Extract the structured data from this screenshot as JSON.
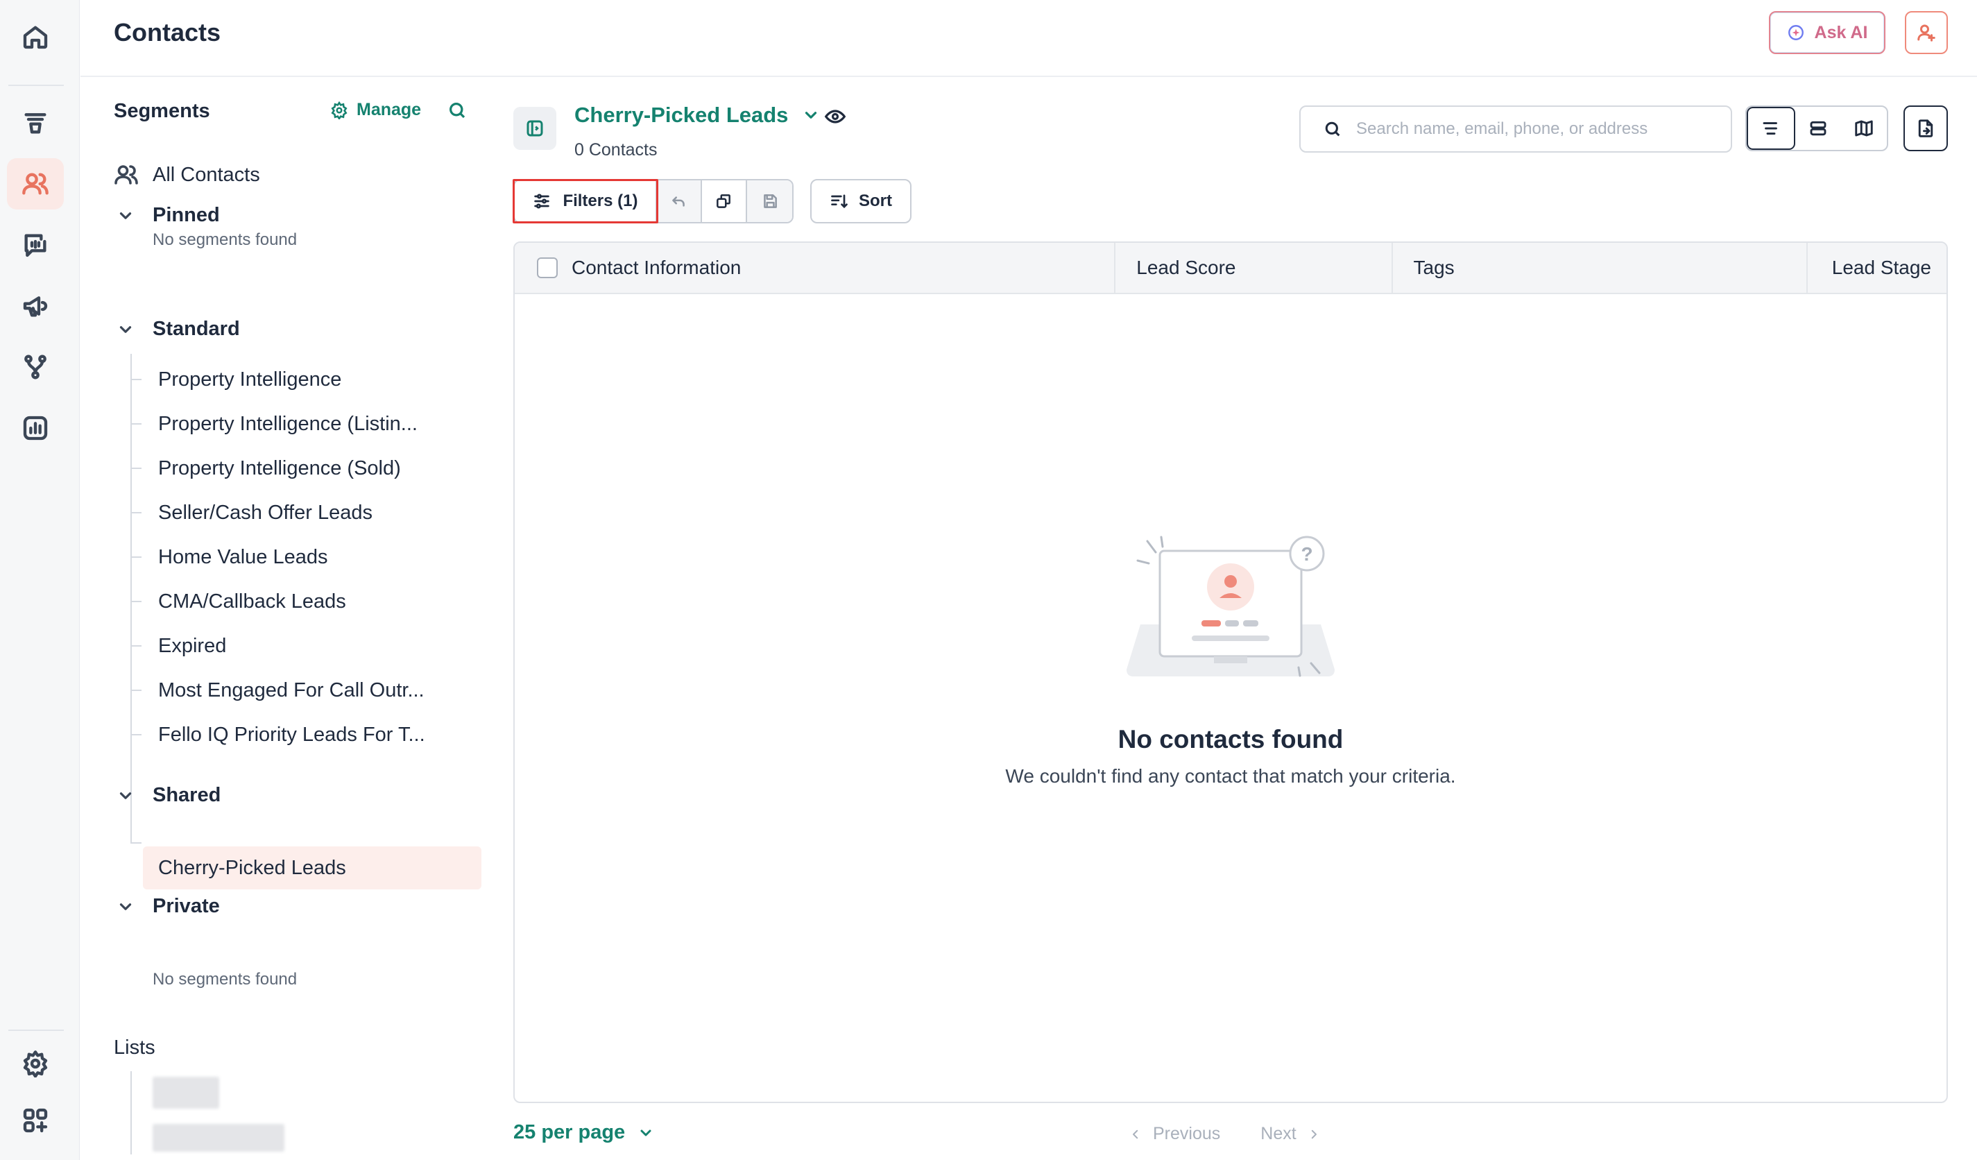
{
  "header": {
    "title": "Contacts",
    "ask_ai_label": "Ask AI"
  },
  "nav": {
    "items": [
      "home-icon",
      "funnel-icon",
      "contacts-icon",
      "messages-icon",
      "megaphone-icon",
      "workflow-icon",
      "reports-icon",
      "settings-icon",
      "apps-icon"
    ],
    "active": "contacts-icon",
    "accent": "#e8735f"
  },
  "segments": {
    "heading": "Segments",
    "manage_label": "Manage",
    "all_contacts_label": "All Contacts",
    "pinned": {
      "label": "Pinned",
      "empty_text": "No segments found"
    },
    "standard": {
      "label": "Standard",
      "items": [
        "Property Intelligence",
        "Property Intelligence (Listin...",
        "Property Intelligence (Sold)",
        "Seller/Cash Offer Leads",
        "Home Value Leads",
        "CMA/Callback Leads",
        "Expired",
        "Most Engaged For Call Outr...",
        "Fello IQ Priority Leads For T..."
      ]
    },
    "shared": {
      "label": "Shared",
      "items": [
        "Cherry-Picked Leads"
      ]
    },
    "private": {
      "label": "Private",
      "empty_text": "No segments found"
    },
    "lists_heading": "Lists"
  },
  "main": {
    "segment_title": "Cherry-Picked Leads",
    "contact_count": "0 Contacts",
    "search_placeholder": "Search name, email, phone, or address",
    "filters_label": "Filters (1)",
    "sort_label": "Sort",
    "columns": [
      "Contact Information",
      "Lead Score",
      "Tags",
      "Lead Stage"
    ],
    "empty_title": "No contacts found",
    "empty_subtitle": "We couldn't find any contact that match your criteria.",
    "per_page_label": "25 per page",
    "previous_label": "Previous",
    "next_label": "Next",
    "brand_color": "#15826f"
  }
}
